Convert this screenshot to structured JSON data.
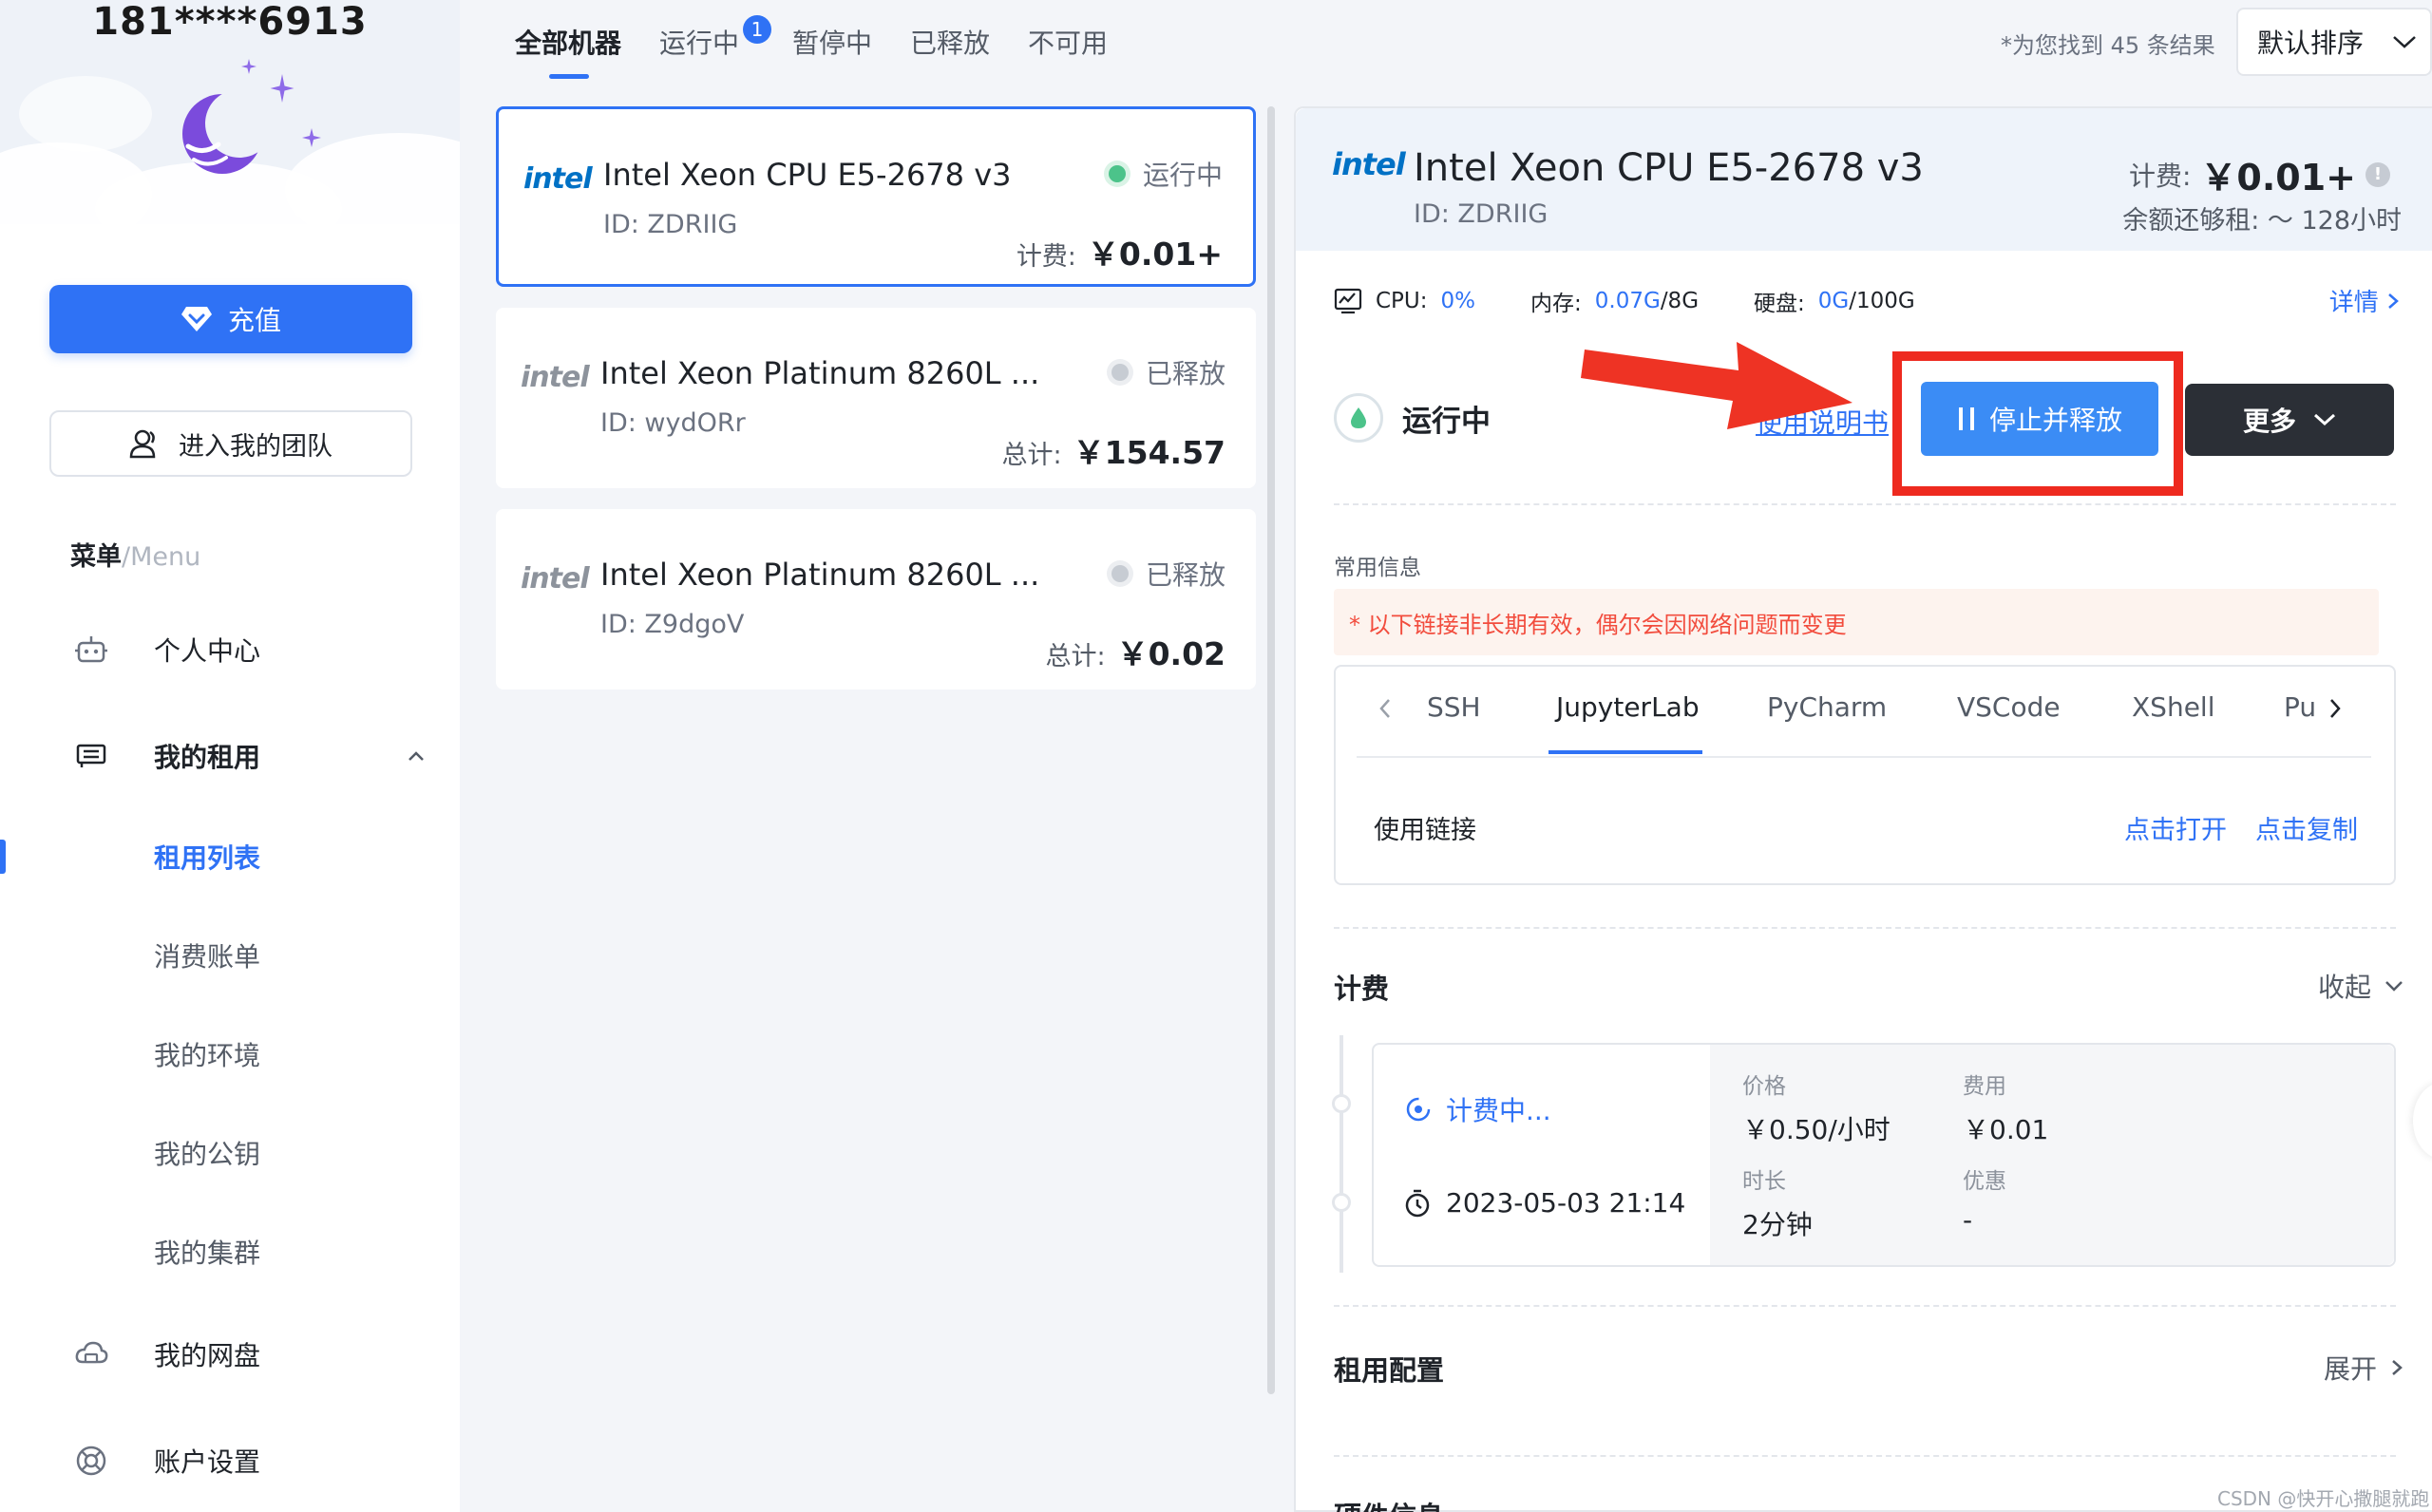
{
  "sidebar": {
    "phone": "181****6913",
    "recharge_label": "充值",
    "team_label": "进入我的团队",
    "menu_title": "菜单",
    "menu_sub": "/Menu",
    "items": [
      {
        "label": "个人中心",
        "icon": "robot-icon"
      },
      {
        "label": "我的租用",
        "icon": "gpu-card-icon"
      },
      {
        "label": "租用列表"
      },
      {
        "label": "消费账单"
      },
      {
        "label": "我的环境"
      },
      {
        "label": "我的公钥"
      },
      {
        "label": "我的集群"
      },
      {
        "label": "我的网盘",
        "icon": "cloud-disk-icon"
      },
      {
        "label": "账户设置",
        "icon": "lifebuoy-icon"
      }
    ]
  },
  "tabs": [
    {
      "label": "全部机器"
    },
    {
      "label": "运行中",
      "badge": "1"
    },
    {
      "label": "暂停中"
    },
    {
      "label": "已释放"
    },
    {
      "label": "不可用"
    }
  ],
  "result_count": "*为您找到 45 条结果",
  "sort": "默认排序",
  "machines": [
    {
      "logo": "intel",
      "name": "Intel Xeon CPU E5-2678 v3",
      "id": "ID: ZDRIIG",
      "status": "运行中",
      "fee_label": "计费:",
      "fee": "￥0.01+"
    },
    {
      "logo": "intel",
      "name": "Intel Xeon Platinum 8260L ...",
      "id": "ID: wydORr",
      "status": "已释放",
      "fee_label": "总计:",
      "fee": "￥154.57"
    },
    {
      "logo": "intel",
      "name": "Intel Xeon Platinum 8260L ...",
      "id": "ID: Z9dgoV",
      "status": "已释放",
      "fee_label": "总计:",
      "fee": "￥0.02"
    }
  ],
  "detail": {
    "logo": "intel",
    "name": "Intel Xeon CPU E5-2678 v3",
    "id": "ID: ZDRIIG",
    "fee_label": "计费:",
    "fee": "￥0.01+",
    "balance": "余额还够租: ～ 128小时",
    "resources": {
      "cpu_label": "CPU:",
      "cpu": "0%",
      "mem_label": "内存:",
      "mem_used": "0.07G",
      "mem_total": "/8G",
      "disk_label": "硬盘:",
      "disk_used": "0G",
      "disk_total": "/100G"
    },
    "detail_link": "详情",
    "status": "运行中",
    "manual": "使用说明书",
    "stop_label": "停止并释放",
    "more_label": "更多",
    "common_info": "常用信息",
    "warning": "* 以下链接非长期有效，偶尔会因网络问题而变更",
    "conn_tabs": [
      "SSH",
      "JupyterLab",
      "PyCharm",
      "VSCode",
      "XShell",
      "Pu"
    ],
    "conn_label": "使用链接",
    "open_link": "点击打开",
    "copy_link": "点击复制",
    "billing_title": "计费",
    "collapse": "收起",
    "billing_state": "计费中...",
    "billing_start": "2023-05-03 21:14",
    "price_label": "价格",
    "price": "￥0.50/小时",
    "cost_label": "费用",
    "cost": "￥0.01",
    "duration_label": "时长",
    "duration": "2分钟",
    "discount_label": "优惠",
    "discount": "-",
    "config_title": "租用配置",
    "expand": "展开",
    "hardware_title": "硬件信息"
  },
  "colors": {
    "accent": "#2f72f5",
    "highlight_box": "#ee2a1f",
    "running": "#4cc38a",
    "released": "#c7ccd3"
  },
  "watermark": "CSDN @快开心撒腿就跑"
}
